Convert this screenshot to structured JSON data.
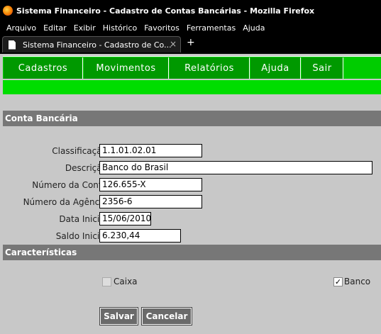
{
  "window": {
    "title": "Sistema Financeiro - Cadastro de Contas Bancárias - Mozilla Firefox"
  },
  "menu": [
    "Arquivo",
    "Editar",
    "Exibir",
    "Histórico",
    "Favoritos",
    "Ferramentas",
    "Ajuda"
  ],
  "tab": {
    "title": "Sistema Financeiro - Cadastro de Co..."
  },
  "nav": [
    "Cadastros",
    "Movimentos",
    "Relatórios",
    "Ajuda",
    "Sair"
  ],
  "sections": {
    "conta": "Conta Bancária",
    "caracteristicas": "Características"
  },
  "form": {
    "classificacao": {
      "label": "Classificação:",
      "value": "1.1.01.02.01"
    },
    "descricao": {
      "label": "Descrição:",
      "value": "Banco do Brasil"
    },
    "numero_conta": {
      "label": "Número da Conta:",
      "value": "126.655-X"
    },
    "numero_agencia": {
      "label": "Número da Agência:",
      "value": "2356-6"
    },
    "data_inicial": {
      "label": "Data Inicial:",
      "value": "15/06/2010"
    },
    "saldo_inicial": {
      "label": "Saldo Inicial:",
      "value": "6.230,44"
    }
  },
  "checkboxes": {
    "caixa": {
      "label": "Caixa",
      "checked": false,
      "disabled": true
    },
    "banco": {
      "label": "Banco",
      "checked": true
    }
  },
  "buttons": {
    "salvar": "Salvar",
    "cancelar": "Cancelar"
  },
  "colors": {
    "nav_green": "#009900",
    "bar_green": "#00dd00",
    "section_gray": "#777777"
  }
}
